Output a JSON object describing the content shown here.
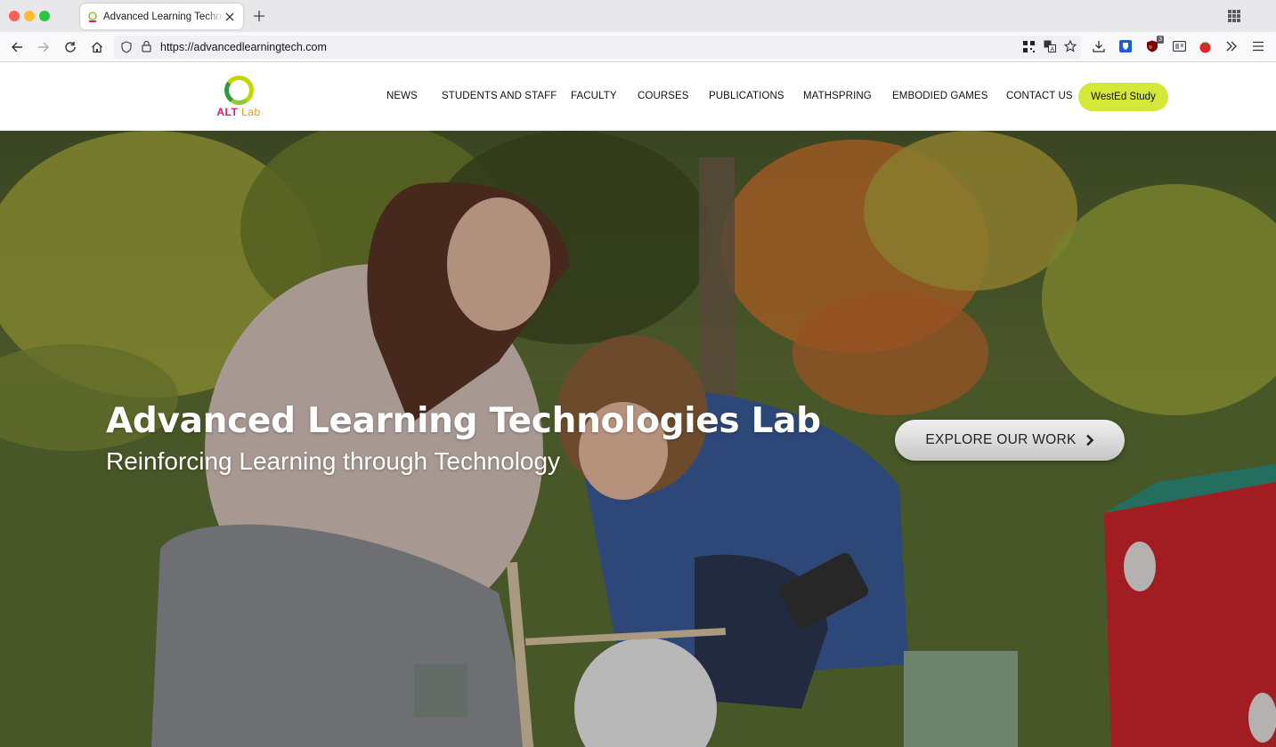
{
  "browser": {
    "tab_title": "Advanced Learning Technologies Lab",
    "url": "https://advancedlearningtech.com",
    "extension_badge": "3",
    "icons": [
      "back-icon",
      "forward-icon",
      "reload-icon",
      "home-icon",
      "shield-icon",
      "lock-icon",
      "qr-code-icon",
      "translate-icon",
      "star-icon",
      "download-icon",
      "bitwarden-icon",
      "ublock-icon",
      "reader-icon",
      "tomato-icon",
      "overflow-icon",
      "menu-icon"
    ]
  },
  "site": {
    "logo": {
      "text_alt": "ALT",
      "text_lab": "Lab"
    },
    "menu": [
      "NEWS",
      "STUDENTS AND STAFF",
      "FACULTY",
      "COURSES",
      "PUBLICATIONS",
      "MATHSPRING",
      "EMBODIED GAMES",
      "CONTACT US"
    ],
    "cta_label": "WestEd Study",
    "cta_color": "#d4e83a"
  },
  "hero": {
    "title": "Advanced Learning Technologies Lab",
    "subtitle": "Reinforcing Learning through Technology",
    "explore_label": "EXPLORE OUR WORK"
  }
}
